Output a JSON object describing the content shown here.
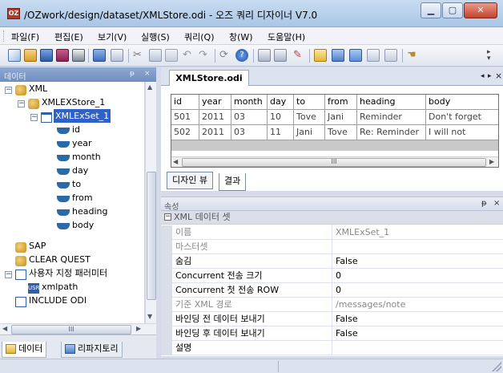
{
  "window": {
    "title": "/OZwork/design/dataset/XMLStore.odi - 오즈 쿼리 디자이너 V7.0",
    "app_icon_text": "OZ"
  },
  "menu": [
    "파일(F)",
    "편집(E)",
    "보기(V)",
    "실행(S)",
    "쿼리(Q)",
    "창(W)",
    "도움말(H)"
  ],
  "toolbar_icons": [
    "new-icon",
    "open-icon",
    "save-icon",
    "save-all-icon",
    "print-icon",
    "copy-db-icon",
    "db-icon",
    "cut-icon",
    "copy-icon",
    "paste-icon",
    "undo-icon",
    "redo-icon",
    "refresh-icon",
    "help-icon",
    "report-icon",
    "report2-icon",
    "link-icon",
    "view1-icon",
    "view2-icon",
    "view3-icon",
    "view4-icon",
    "view5-icon",
    "hand-icon"
  ],
  "left_panel": {
    "title": "데이터",
    "pin": "ᵽ",
    "close": "×",
    "tree": {
      "root": "XML",
      "store": "XMLEXStore_1",
      "set": "XMLExSet_1",
      "fields": [
        "id",
        "year",
        "month",
        "day",
        "to",
        "from",
        "heading",
        "body"
      ],
      "sap": "SAP",
      "clear_quest": "CLEAR QUEST",
      "user_params": "사용자 지정 패러미터",
      "xmlpath": "xmlpath",
      "include_odi": "INCLUDE ODI"
    },
    "tabs": [
      "데이터",
      "리파지토리"
    ],
    "scroll_dots": "III"
  },
  "doc": {
    "tab": "XMLStore.odi",
    "controls": [
      "◂",
      "▸",
      "×"
    ]
  },
  "grid": {
    "columns": [
      "id",
      "year",
      "month",
      "day",
      "to",
      "from",
      "heading",
      "body"
    ],
    "rows": [
      [
        "501",
        "2011",
        "03",
        "10",
        "Tove",
        "Jani",
        "Reminder",
        "Don't forget"
      ],
      [
        "502",
        "2011",
        "03",
        "11",
        "Jani",
        "Tove",
        "Re: Reminder",
        "I will not"
      ]
    ],
    "scroll_dots": "III"
  },
  "view_tabs": [
    "디자인 뷰",
    "결과"
  ],
  "properties": {
    "title": "속성",
    "pin": "ᵽ",
    "close": "×",
    "category": "XML 데이터 셋",
    "rows": [
      {
        "name": "이름",
        "value": "XMLExSet_1",
        "grey": true
      },
      {
        "name": "마스터셋",
        "value": "",
        "grey": true
      },
      {
        "name": "숨김",
        "value": "False",
        "grey": false
      },
      {
        "name": "Concurrent 전송 크기",
        "value": "0",
        "grey": false
      },
      {
        "name": "Concurrent 첫 전송 ROW",
        "value": "0",
        "grey": false
      },
      {
        "name": "기준 XML 경로",
        "value": "/messages/note",
        "grey": true
      },
      {
        "name": "바인딩 전 데이터 보내기",
        "value": "False",
        "grey": false
      },
      {
        "name": "바인딩 후 데이터 보내기",
        "value": "False",
        "grey": false
      },
      {
        "name": "설명",
        "value": "",
        "grey": false
      }
    ]
  }
}
